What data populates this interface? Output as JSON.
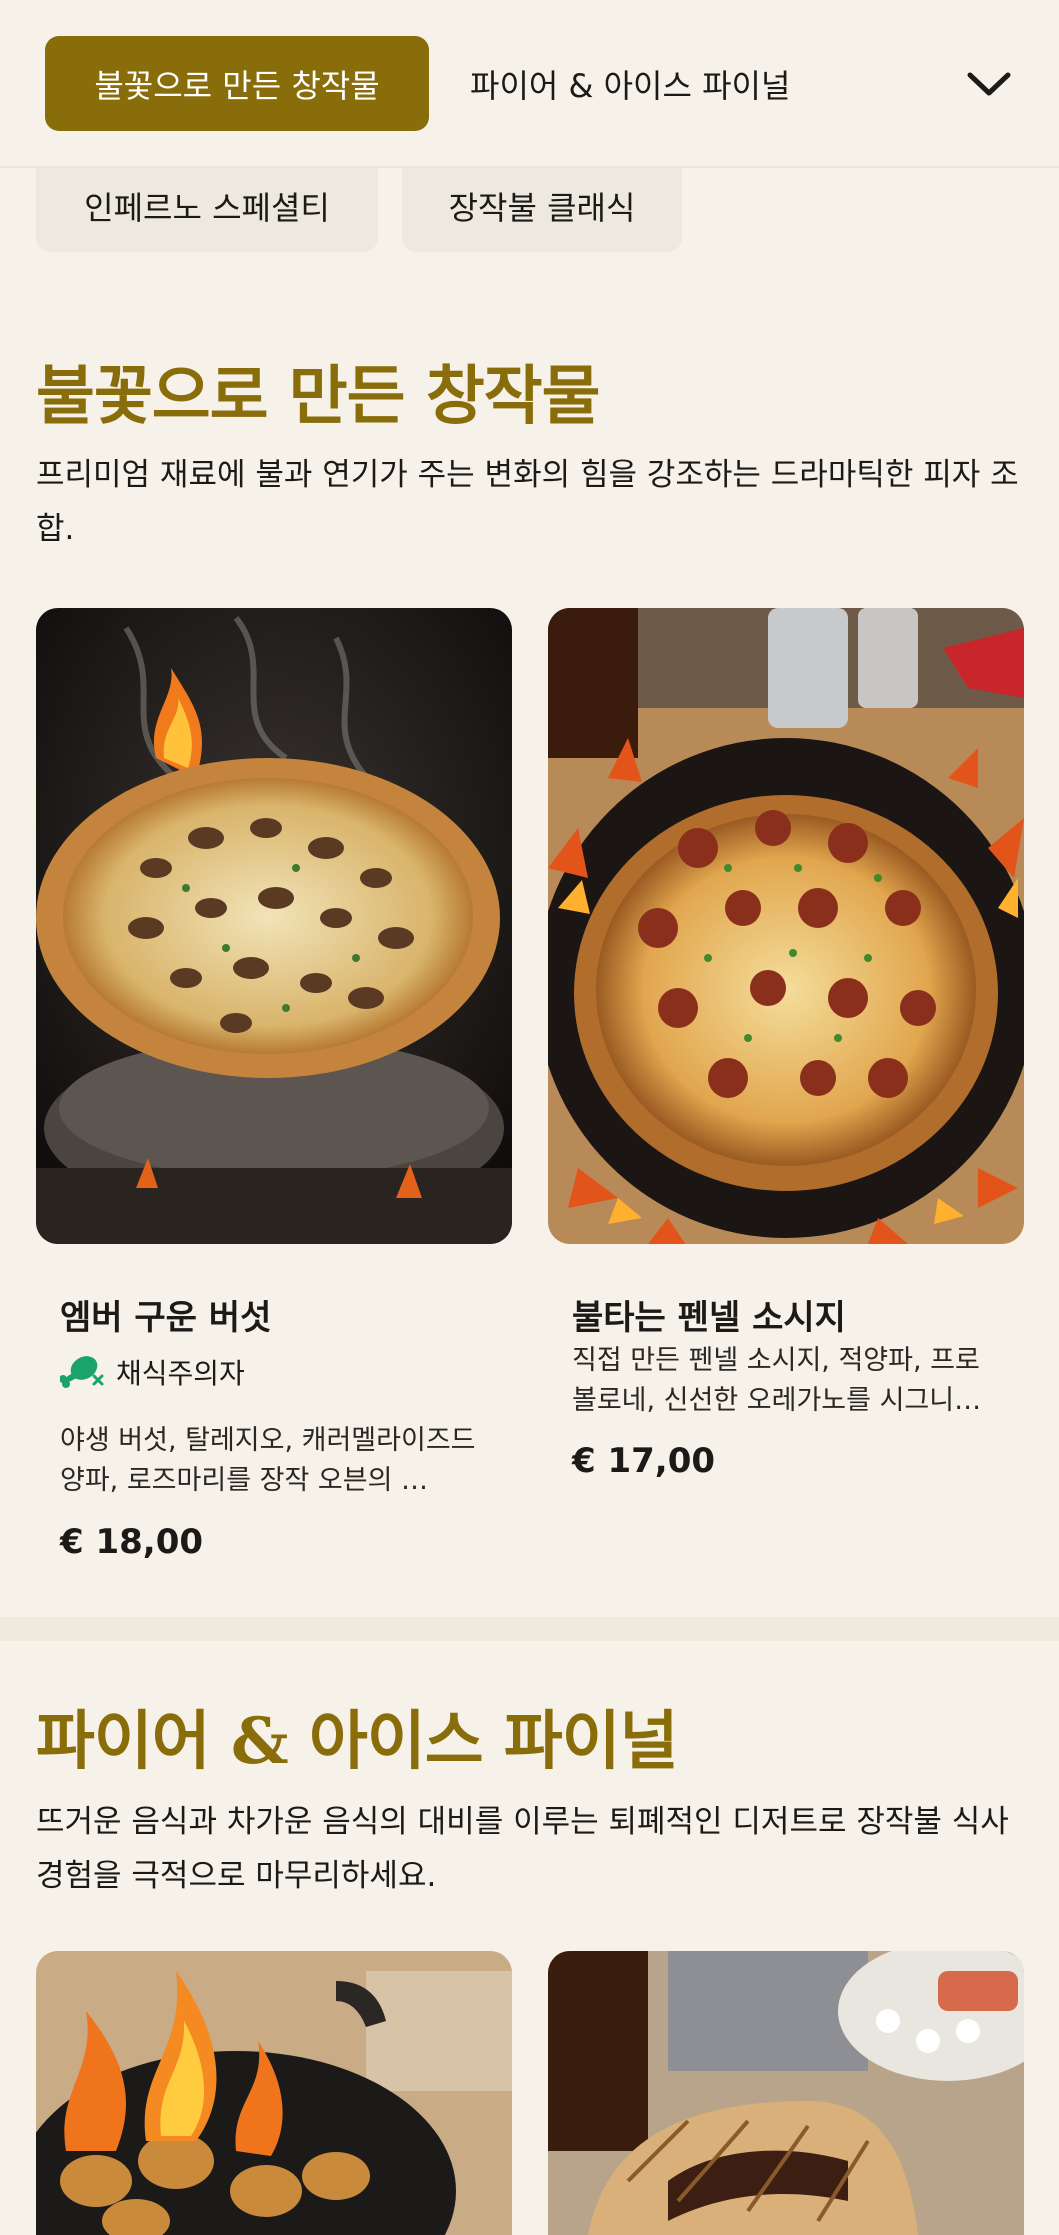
{
  "nav": {
    "active_tab": "불꽃으로 만든 창작물",
    "second_tab": "파이어 & 아이스 파이널",
    "chips": [
      "인페르노 스페셜티",
      "장작불 클래식"
    ],
    "expand_icon": "chevron-down-icon"
  },
  "section1": {
    "title": "불꽃으로 만든 창작물",
    "description": "프리미엄 재료에 불과 연기가 주는 변화의 힘을 강조하는 드라마틱한 피자 조합.",
    "items": [
      {
        "name": "엠버 구운 버섯",
        "badge": "채식주의자",
        "badge_icon": "vegetarian-drumstick-icon",
        "description": "야생 버섯, 탈레지오, 캐러멜라이즈드 양파, 로즈마리를 장작 오븐의 …",
        "price": "€ 18,00"
      },
      {
        "name": "불타는 펜넬 소시지",
        "description": "직접 만든 펜넬 소시지, 적양파, 프로볼로네, 신선한 오레가노를 시그니…",
        "price": "€ 17,00"
      }
    ]
  },
  "section2": {
    "title": "파이어 & 아이스 파이널",
    "description": "뜨거운 음식과 차가운 음식의 대비를 이루는 퇴폐적인 디저트로 장작불 식사 경험을 극적으로 마무리하세요."
  },
  "colors": {
    "accent": "#8a6d0b",
    "background": "#f6f2ea",
    "badge_green": "#1aa46a"
  }
}
